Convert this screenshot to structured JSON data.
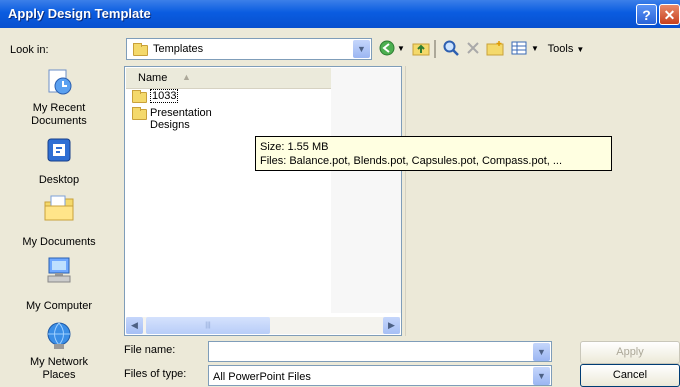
{
  "window": {
    "title": "Apply Design Template",
    "help_glyph": "?",
    "close_glyph": "✕"
  },
  "lookin": {
    "label": "Look in:",
    "value": "Templates"
  },
  "toolbar": {
    "tools_label": "Tools",
    "back_icon": "back-icon",
    "up_icon": "up-folder-icon",
    "search_icon": "search-web-icon",
    "delete_icon": "delete-icon",
    "new_folder_icon": "new-folder-icon",
    "views_icon": "views-icon"
  },
  "places": [
    {
      "label_line1": "My Recent",
      "label_line2": "Documents"
    },
    {
      "label_line1": "Desktop",
      "label_line2": ""
    },
    {
      "label_line1": "My Documents",
      "label_line2": ""
    },
    {
      "label_line1": "My Computer",
      "label_line2": ""
    },
    {
      "label_line1": "My Network",
      "label_line2": "Places"
    }
  ],
  "filelist": {
    "column_name": "Name",
    "items": [
      "1033",
      "Presentation Designs"
    ]
  },
  "tooltip": {
    "line1": "Size: 1.55 MB",
    "line2": "Files: Balance.pot, Blends.pot, Capsules.pot, Compass.pot, ..."
  },
  "footer": {
    "file_name_label": "File name:",
    "file_name_value": "",
    "file_type_label": "Files of type:",
    "file_type_value": "All PowerPoint Files",
    "apply_label": "Apply",
    "cancel_label": "Cancel"
  },
  "colors": {
    "titlebar": "#0a5ce0",
    "dialog_bg": "#ece9d8",
    "tooltip_bg": "#ffffe1"
  }
}
